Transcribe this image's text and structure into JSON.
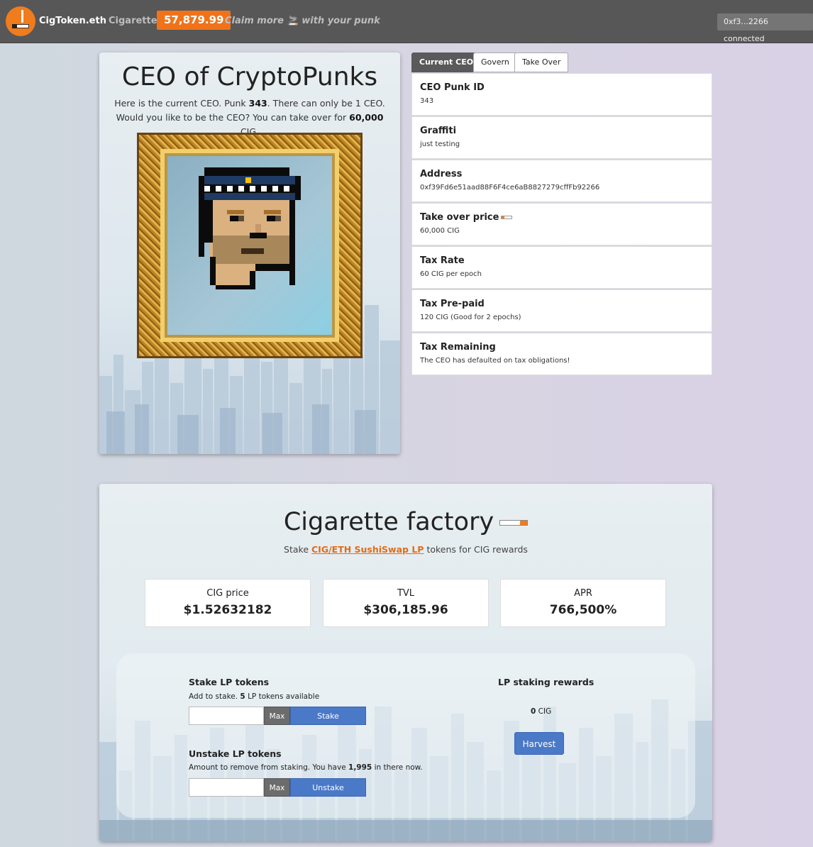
{
  "navbar": {
    "brand": "CigToken.eth",
    "cigarettes_label": "Cigarettes",
    "balance": "57,879.99",
    "claim_text": "Claim more 🚬 with your punk",
    "wallet": "0xf3...2266 connected",
    "brand_color": "#f07c1e"
  },
  "ceo": {
    "title": "CEO of CryptoPunks",
    "desc_1": "Here is the current CEO. Punk ",
    "punk_id": "343",
    "desc_2": ". There can only be 1 CEO. Would you like to be the CEO? You can take over for ",
    "price": "60,000",
    "desc_3": " CIG.",
    "image_icon": "punk-portrait"
  },
  "tabs": [
    {
      "label": "Current CEO",
      "active": true
    },
    {
      "label": "Govern",
      "active": false
    },
    {
      "label": "Take Over",
      "active": false
    }
  ],
  "info": [
    {
      "label": "CEO Punk ID",
      "value": "343"
    },
    {
      "label": "Graffiti",
      "value": "just testing"
    },
    {
      "label": "Address",
      "value": "0xf39Fd6e51aad88F6F4ce6aB8827279cffFb92266"
    },
    {
      "label": "Take over price",
      "value": "60,000 CIG"
    },
    {
      "label": "Tax Rate",
      "value": "60 CIG per epoch"
    },
    {
      "label": "Tax Pre-paid",
      "value": "120 CIG (Good for 2 epochs)"
    },
    {
      "label": "Tax Remaining",
      "value": "The CEO has defaulted on tax obligations!"
    }
  ],
  "factory": {
    "title": "Cigarette factory",
    "sub_1": "Stake ",
    "sub_link": "CIG/ETH SushiSwap LP",
    "sub_2": " tokens for CIG rewards",
    "stats": [
      {
        "label": "CIG price",
        "value": "$1.52632182"
      },
      {
        "label": "TVL",
        "value": "$306,185.96"
      },
      {
        "label": "APR",
        "value": "766,500%"
      }
    ],
    "stake": {
      "title": "Stake LP tokens",
      "desc_1": "Add to stake. ",
      "available": "5",
      "desc_2": " LP tokens available",
      "max_label": "Max",
      "button": "Stake",
      "placeholder": ""
    },
    "unstake": {
      "title": "Unstake LP tokens",
      "desc_1": "Amount to remove from staking. You have ",
      "staked": "1,995",
      "desc_2": " in there now.",
      "max_label": "Max",
      "button": "Unstake",
      "placeholder": ""
    },
    "rewards": {
      "title": "LP staking rewards",
      "amount": "0",
      "unit": " CIG",
      "button": "Harvest"
    }
  }
}
